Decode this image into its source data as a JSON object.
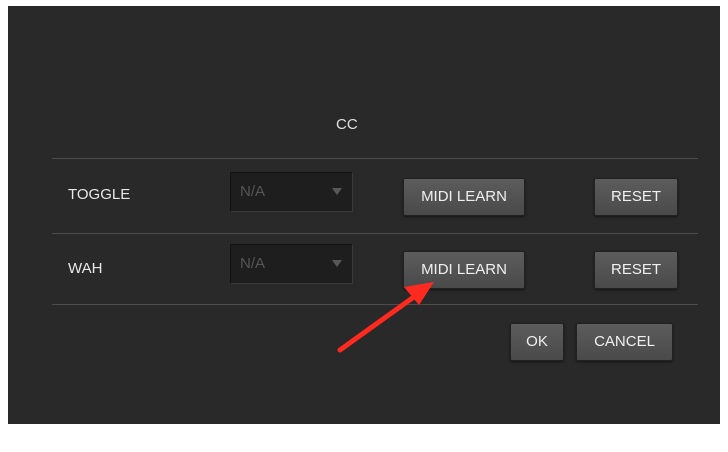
{
  "header": {
    "cc_label": "CC"
  },
  "rows": [
    {
      "label": "TOGGLE",
      "cc_value": "N/A",
      "midi_learn_label": "MIDI LEARN",
      "reset_label": "RESET"
    },
    {
      "label": "WAH",
      "cc_value": "N/A",
      "midi_learn_label": "MIDI LEARN",
      "reset_label": "RESET"
    }
  ],
  "footer": {
    "ok_label": "OK",
    "cancel_label": "CANCEL"
  },
  "annotation": {
    "arrow_color": "#ff2a1f"
  },
  "icons": {
    "dropdown_arrow": "chevron-down-icon"
  }
}
